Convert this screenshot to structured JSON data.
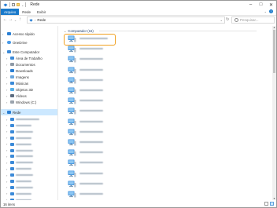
{
  "window": {
    "title": "Rede",
    "minimize_glyph": "–",
    "maximize_glyph": "□",
    "close_glyph": "✕"
  },
  "ribbon": {
    "tabs": [
      "Arquivo",
      "Rede",
      "Exibir"
    ],
    "help_glyph": "?"
  },
  "navigation": {
    "back_glyph": "←",
    "forward_glyph": "→",
    "recent_glyph": "⌄",
    "up_glyph": "↑",
    "address_path": "Rede",
    "refresh_glyph": "↻",
    "search_placeholder": "Pesquisar..."
  },
  "sidebar": {
    "items": [
      {
        "label": "Acesso rápido",
        "icon": "star-icon",
        "expand": "›",
        "level": 0
      },
      {
        "label": "OneDrive",
        "icon": "cloud-icon",
        "expand": "›",
        "level": 0
      },
      {
        "label": "Este Computador",
        "icon": "computer-icon",
        "expand": "⌄",
        "level": 0
      },
      {
        "label": "Área de Trabalho",
        "icon": "desktop-icon",
        "expand": "›",
        "level": 1
      },
      {
        "label": "Documentos",
        "icon": "documents-icon",
        "expand": "›",
        "level": 1
      },
      {
        "label": "Downloads",
        "icon": "downloads-icon",
        "expand": "›",
        "level": 1
      },
      {
        "label": "Imagens",
        "icon": "pictures-icon",
        "expand": "›",
        "level": 1
      },
      {
        "label": "Músicas",
        "icon": "music-icon",
        "expand": "›",
        "level": 1
      },
      {
        "label": "Objetos 3D",
        "icon": "3d-objects-icon",
        "expand": "›",
        "level": 1
      },
      {
        "label": "Vídeos",
        "icon": "videos-icon",
        "expand": "›",
        "level": 1
      },
      {
        "label": "Windows (C:)",
        "icon": "drive-icon",
        "expand": "›",
        "level": 1
      },
      {
        "label": "Rede",
        "icon": "network-icon",
        "expand": "⌄",
        "level": 0,
        "selected": true
      }
    ],
    "network_children_count": 14,
    "accent_color": "#cce8ff"
  },
  "content": {
    "group_header": "Computador (16)",
    "group_chevron": "⌄",
    "devices_count": 16,
    "highlight_color": "#f0a020"
  },
  "statusbar": {
    "item_count": "16 itens"
  }
}
